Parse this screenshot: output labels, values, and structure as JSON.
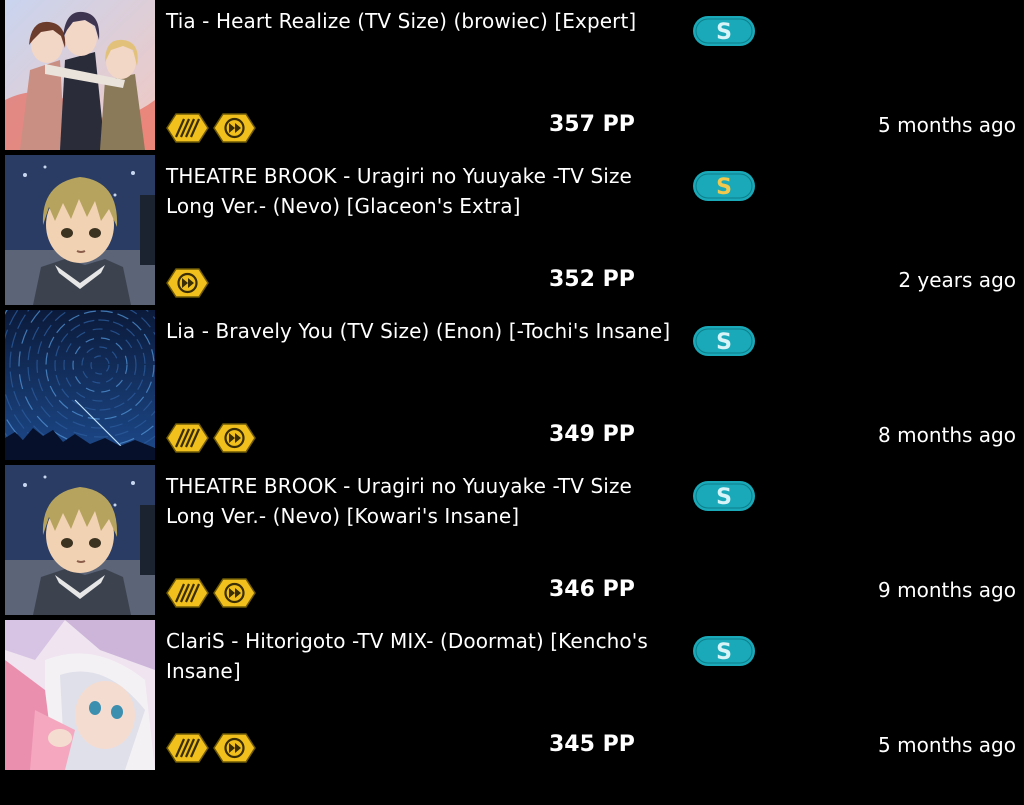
{
  "scores": [
    {
      "title": "Tia - Heart Realize (TV Size) (browiec) [Expert]",
      "rank": "S",
      "rank_color": "#19a9b8",
      "rank_letter_color": "#d8f4f8",
      "mods": [
        "hidden-icon",
        "doubletime-icon"
      ],
      "pp": "357 PP",
      "date": "5 months ago",
      "thumb": "anime-group-art"
    },
    {
      "title": "THEATRE BROOK - Uragiri no Yuuyake -TV Size Long Ver.- (Nevo) [Glaceon's Extra]",
      "rank": "S",
      "rank_color": "#19a9b8",
      "rank_letter_color": "#f2c94c",
      "mods": [
        "doubletime-icon"
      ],
      "pp": "352 PP",
      "date": "2 years ago",
      "thumb": "anime-boy-art"
    },
    {
      "title": "Lia - Bravely You (TV Size) (Enon) [-Tochi's Insane]",
      "rank": "S",
      "rank_color": "#19a9b8",
      "rank_letter_color": "#d8f4f8",
      "mods": [
        "hidden-icon",
        "doubletime-icon"
      ],
      "pp": "349 PP",
      "date": "8 months ago",
      "thumb": "star-trail-art"
    },
    {
      "title": "THEATRE BROOK - Uragiri no Yuuyake -TV Size Long Ver.- (Nevo) [Kowari's Insane]",
      "rank": "S",
      "rank_color": "#19a9b8",
      "rank_letter_color": "#d8f4f8",
      "mods": [
        "hidden-icon",
        "doubletime-icon"
      ],
      "pp": "346 PP",
      "date": "9 months ago",
      "thumb": "anime-boy-art"
    },
    {
      "title": "ClariS - Hitorigoto -TV MIX- (Doormat) [Kencho's Insane]",
      "rank": "S",
      "rank_color": "#19a9b8",
      "rank_letter_color": "#d8f4f8",
      "mods": [
        "hidden-icon",
        "doubletime-icon"
      ],
      "pp": "345 PP",
      "date": "5 months ago",
      "thumb": "anime-girl-art"
    }
  ]
}
